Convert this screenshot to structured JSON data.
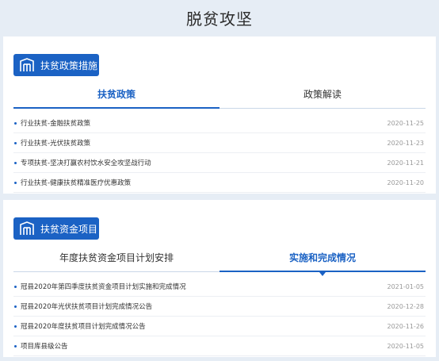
{
  "page_title": "脱贫攻坚",
  "section1": {
    "button_label": "扶贫政策措施",
    "tabs": [
      "扶贫政策",
      "政策解读"
    ],
    "items": [
      {
        "title": "行业扶贫-金融扶贫政策",
        "date": "2020-11-25"
      },
      {
        "title": "行业扶贫-光伏扶贫政策",
        "date": "2020-11-23"
      },
      {
        "title": "专项扶贫-坚决打赢农村饮水安全攻坚战行动",
        "date": "2020-11-21"
      },
      {
        "title": "行业扶贫-健康扶贫精准医疗优惠政策",
        "date": "2020-11-20"
      }
    ]
  },
  "section2": {
    "button_label": "扶贫资金项目",
    "tabs": [
      "年度扶贫资金项目计划安排",
      "实施和完成情况"
    ],
    "items": [
      {
        "title": "冠县2020年第四季度扶贫资金项目计划实施和完成情况",
        "date": "2021-01-05"
      },
      {
        "title": "冠县2020年光伏扶贫项目计划完成情况公告",
        "date": "2020-12-28"
      },
      {
        "title": "冠县2020年度扶贫项目计划完成情况公告",
        "date": "2020-11-26"
      },
      {
        "title": "项目库县级公告",
        "date": "2020-11-05"
      }
    ]
  },
  "colors": {
    "accent": "#1b62c4",
    "background": "#e6edf5"
  },
  "icons": {
    "section_icon": "building-icon"
  }
}
